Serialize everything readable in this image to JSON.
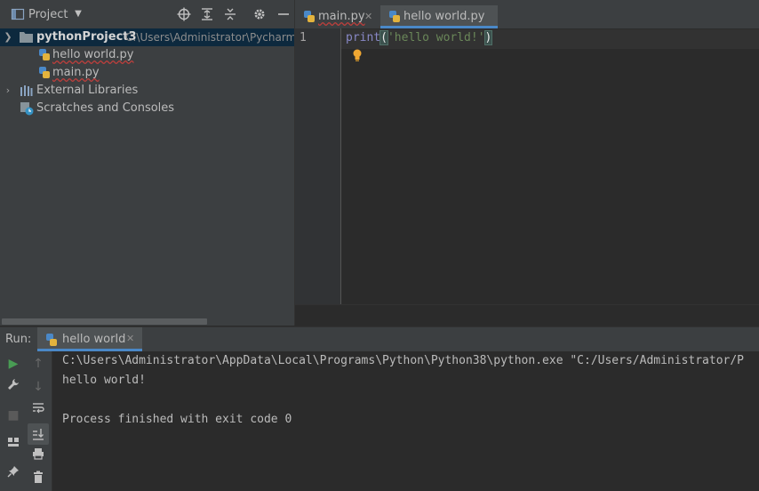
{
  "project_panel": {
    "title": "Project",
    "tree": {
      "root_name": "pythonProject3",
      "root_path": "C:\\Users\\Administrator\\PycharmP",
      "files": [
        "hello world.py",
        "main.py"
      ],
      "external_libraries": "External Libraries",
      "scratches": "Scratches and Consoles"
    }
  },
  "editor": {
    "tabs": [
      {
        "label": "main.py",
        "active": false
      },
      {
        "label": "hello world.py",
        "active": true
      }
    ],
    "line_number": "1",
    "code": {
      "fn": "print",
      "open_paren": "(",
      "string": "'hello world!'",
      "close_paren": ")"
    }
  },
  "run_panel": {
    "label": "Run:",
    "tab_label": "hello world",
    "console_lines": [
      "C:\\Users\\Administrator\\AppData\\Local\\Programs\\Python\\Python38\\python.exe \"C:/Users/Administrator/P",
      "hello world!",
      "",
      "Process finished with exit code 0"
    ]
  },
  "colors": {
    "accent": "#4a88c7",
    "run_green": "#499c54",
    "string_green": "#6a8759",
    "keyword_purple": "#8888c6"
  },
  "icons": {
    "project_view": "project-view-icon",
    "locate": "locate-crosshair-icon",
    "expand_all": "expand-all-icon",
    "collapse_all": "collapse-all-icon",
    "settings": "gear-icon",
    "hide": "minimize-icon",
    "python_file": "python-file-icon",
    "library": "library-icon",
    "scratches": "scratches-icon",
    "intention_bulb": "lightbulb-icon",
    "run": "play-icon",
    "wrench": "wrench-icon",
    "stop": "stop-icon",
    "layout": "layout-icon",
    "pin": "pin-icon",
    "up": "arrow-up-icon",
    "down": "arrow-down-icon",
    "soft_wrap": "soft-wrap-icon",
    "scroll_end": "scroll-to-end-icon",
    "print": "print-icon",
    "trash": "trash-icon"
  }
}
